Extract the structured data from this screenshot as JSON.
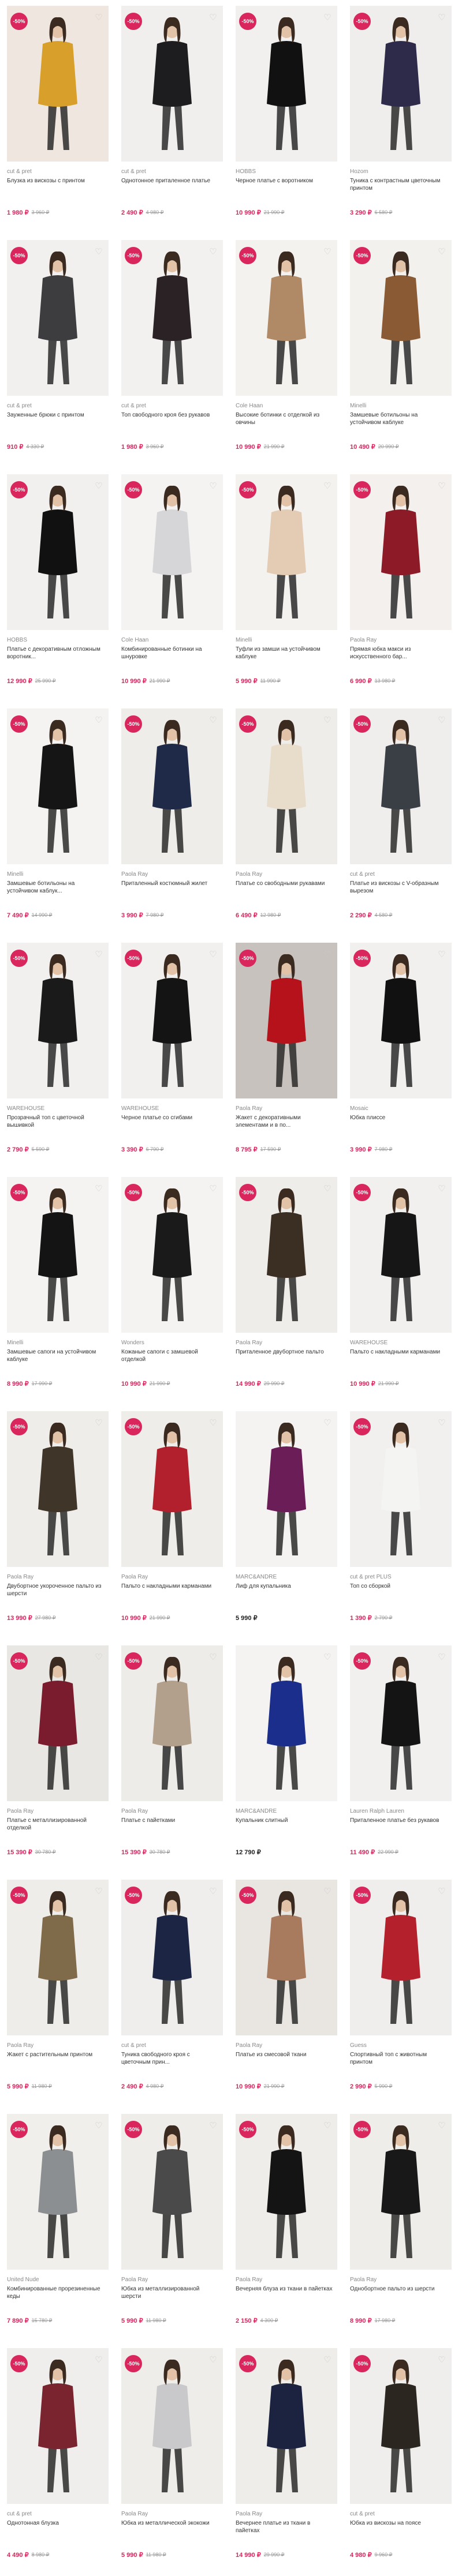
{
  "colors": {
    "accent": "#d9275e",
    "old_price": "#999999",
    "bg_photo": "#f3f1ef"
  },
  "icons": {
    "favorite": "heart-outline-icon"
  },
  "products": [
    {
      "badge": "-50%",
      "brand": "cut & pret",
      "title": "Блузка из вискозы с принтом",
      "price": "1 980 ₽",
      "old_price": "3 960 ₽",
      "bg": "#efe7df",
      "c": "#d8a02b"
    },
    {
      "badge": "-50%",
      "brand": "cut & pret",
      "title": "Однотонное приталенное платье",
      "price": "2 490 ₽",
      "old_price": "4 980 ₽",
      "bg": "#f0efed",
      "c": "#1d1d1f"
    },
    {
      "badge": "-50%",
      "brand": "HOBBS",
      "title": "Черное платье с воротником",
      "price": "10 990 ₽",
      "old_price": "21 990 ₽",
      "bg": "#f1f0ef",
      "c": "#111"
    },
    {
      "badge": "-50%",
      "brand": "Hozom",
      "title": "Туника с контрастным цветочным принтом",
      "price": "3 290 ₽",
      "old_price": "6 580 ₽",
      "bg": "#efeeec",
      "c": "#2e2b4a"
    },
    {
      "badge": "-50%",
      "brand": "cut & pret",
      "title": "Зауженные брюки с принтом",
      "price": "910 ₽",
      "old_price": "4 330 ₽",
      "bg": "#f1f0ee",
      "c": "#3d3d40"
    },
    {
      "badge": "-50%",
      "brand": "cut & pret",
      "title": "Топ свободного кроя без рукавов",
      "price": "1 980 ₽",
      "old_price": "3 960 ₽",
      "bg": "#f2f1ef",
      "c": "#2b2226"
    },
    {
      "badge": "-50%",
      "brand": "Cole Haan",
      "title": "Высокие ботинки с отделкой из овчины",
      "price": "10 990 ₽",
      "old_price": "21 990 ₽",
      "bg": "#f4f2ef",
      "c": "#b08a66"
    },
    {
      "badge": "-50%",
      "brand": "Minelli",
      "title": "Замшевые ботильоны на устойчивом каблуке",
      "price": "10 490 ₽",
      "old_price": "20 990 ₽",
      "bg": "#f3f1ee",
      "c": "#8a5a34"
    },
    {
      "badge": "-50%",
      "brand": "HOBBS",
      "title": "Платье с декоративным отложным воротник...",
      "price": "12 990 ₽",
      "old_price": "25 990 ₽",
      "bg": "#f1f0ef",
      "c": "#111"
    },
    {
      "badge": "-50%",
      "brand": "Cole Haan",
      "title": "Комбинированные ботинки на шнуровке",
      "price": "10 990 ₽",
      "old_price": "21 990 ₽",
      "bg": "#f4f3f2",
      "c": "#d6d6d8"
    },
    {
      "badge": "-50%",
      "brand": "Minelli",
      "title": "Туфли из замши на устойчивом каблуке",
      "price": "5 990 ₽",
      "old_price": "11 990 ₽",
      "bg": "#f4f2ef",
      "c": "#e3cbb4"
    },
    {
      "badge": "-50%",
      "brand": "Paola Ray",
      "title": "Прямая юбка макси из искусственного бар...",
      "price": "6 990 ₽",
      "old_price": "13 980 ₽",
      "bg": "#f3f0ee",
      "c": "#8d1a27"
    },
    {
      "badge": "-50%",
      "brand": "Minelli",
      "title": "Замшевые ботильоны на устойчивом каблук...",
      "price": "7 490 ₽",
      "old_price": "14 990 ₽",
      "bg": "#f4f3f2",
      "c": "#151515"
    },
    {
      "badge": "-50%",
      "brand": "Paola Ray",
      "title": "Приталенный костюмный жилет",
      "price": "3 990 ₽",
      "old_price": "7 980 ₽",
      "bg": "#eeede9",
      "c": "#1f2a49"
    },
    {
      "badge": "-50%",
      "brand": "Paola Ray",
      "title": "Платье со свободными рукавами",
      "price": "6 490 ₽",
      "old_price": "12 980 ₽",
      "bg": "#efede9",
      "c": "#e8dccb"
    },
    {
      "badge": "-50%",
      "brand": "cut & pret",
      "title": "Платье из вискозы с V-образным вырезом",
      "price": "2 290 ₽",
      "old_price": "4 580 ₽",
      "bg": "#efeeec",
      "c": "#3a3f45"
    },
    {
      "badge": "-50%",
      "brand": "WAREHOUSE",
      "title": "Прозрачный топ с цветочной вышивкой",
      "price": "2 790 ₽",
      "old_price": "5 590 ₽",
      "bg": "#f1f0ee",
      "c": "#1a1a1a"
    },
    {
      "badge": "-50%",
      "brand": "WAREHOUSE",
      "title": "Черное платье со сгибами",
      "price": "3 390 ₽",
      "old_price": "6 790 ₽",
      "bg": "#f1f0ee",
      "c": "#141414"
    },
    {
      "badge": "-50%",
      "brand": "Paola Ray",
      "title": "Жакет с декоративными элементами и в по...",
      "price": "8 795 ₽",
      "old_price": "17 590 ₽",
      "bg": "#c7c2bd",
      "c": "#b5121b"
    },
    {
      "badge": "-50%",
      "brand": "Mosaic",
      "title": "Юбка плиссе",
      "price": "3 990 ₽",
      "old_price": "7 980 ₽",
      "bg": "#f1f0ee",
      "c": "#111"
    },
    {
      "badge": "-50%",
      "brand": "Minelli",
      "title": "Замшевые сапоги на устойчивом каблуке",
      "price": "8 990 ₽",
      "old_price": "17 990 ₽",
      "bg": "#f4f3f2",
      "c": "#141414"
    },
    {
      "badge": "-50%",
      "brand": "Wonders",
      "title": "Кожаные сапоги с замшевой отделкой",
      "price": "10 990 ₽",
      "old_price": "21 990 ₽",
      "bg": "#f4f3f2",
      "c": "#1a1a1a"
    },
    {
      "badge": "-50%",
      "brand": "Paola Ray",
      "title": "Приталенное двубортное пальто",
      "price": "14 990 ₽",
      "old_price": "29 990 ₽",
      "bg": "#efede9",
      "c": "#3b2f24"
    },
    {
      "badge": "-50%",
      "brand": "WAREHOUSE",
      "title": "Пальто с накладными карманами",
      "price": "10 990 ₽",
      "old_price": "21 990 ₽",
      "bg": "#f1f0ee",
      "c": "#161616"
    },
    {
      "badge": "-50%",
      "brand": "Paola Ray",
      "title": "Двубортное укороченное пальто из шерсти",
      "price": "13 990 ₽",
      "old_price": "27 980 ₽",
      "bg": "#efede9",
      "c": "#3f3528"
    },
    {
      "badge": "-50%",
      "brand": "Paola Ray",
      "title": "Пальто с накладными карманами",
      "price": "10 990 ₽",
      "old_price": "21 990 ₽",
      "bg": "#efede9",
      "c": "#b21f2d"
    },
    {
      "badge": "",
      "brand": "MARC&ANDRE",
      "title": "Лиф для купальника",
      "price": "5 990 ₽",
      "old_price": "",
      "bg": "#f4f3f2",
      "c": "#6b1d57"
    },
    {
      "badge": "-50%",
      "brand": "cut & pret PLUS",
      "title": "Топ со сборкой",
      "price": "1 390 ₽",
      "old_price": "2 790 ₽",
      "bg": "#f1f0ee",
      "c": "#f4f4f2"
    },
    {
      "badge": "-50%",
      "brand": "Paola Ray",
      "title": "Платье с металлизированной отделкой",
      "price": "15 390 ₽",
      "old_price": "30 780 ₽",
      "bg": "#e9e7e3",
      "c": "#7a1c2e"
    },
    {
      "badge": "-50%",
      "brand": "Paola Ray",
      "title": "Платье с пайетками",
      "price": "15 390 ₽",
      "old_price": "30 780 ₽",
      "bg": "#eeece8",
      "c": "#b3a08c"
    },
    {
      "badge": "",
      "brand": "MARC&ANDRE",
      "title": "Купальник слитный",
      "price": "12 790 ₽",
      "old_price": "",
      "bg": "#f4f3f2",
      "c": "#1b2e8c"
    },
    {
      "badge": "-50%",
      "brand": "Lauren Ralph Lauren",
      "title": "Приталенное платье без рукавов",
      "price": "11 490 ₽",
      "old_price": "22 990 ₽",
      "bg": "#f1f0ee",
      "c": "#141414"
    },
    {
      "badge": "-50%",
      "brand": "Paola Ray",
      "title": "Жакет с растительным принтом",
      "price": "5 990 ₽",
      "old_price": "11 980 ₽",
      "bg": "#efede9",
      "c": "#7f6a4a"
    },
    {
      "badge": "-50%",
      "brand": "cut & pret",
      "title": "Туника свободного кроя с цветочным прин...",
      "price": "2 490 ₽",
      "old_price": "4 980 ₽",
      "bg": "#efeeec",
      "c": "#1c2544"
    },
    {
      "badge": "-50%",
      "brand": "Paola Ray",
      "title": "Платье из смесовой ткани",
      "price": "10 990 ₽",
      "old_price": "21 990 ₽",
      "bg": "#e9e6e2",
      "c": "#a87a5e"
    },
    {
      "badge": "-50%",
      "brand": "Guess",
      "title": "Спортивный топ с животным принтом",
      "price": "2 990 ₽",
      "old_price": "5 990 ₽",
      "bg": "#efeeec",
      "c": "#b4202c"
    },
    {
      "badge": "-50%",
      "brand": "United Nude",
      "title": "Комбинированные прорезиненные кеды",
      "price": "7 890 ₽",
      "old_price": "15 780 ₽",
      "bg": "#f1efec",
      "c": "#8c8f92"
    },
    {
      "badge": "-50%",
      "brand": "Paola Ray",
      "title": "Юбка из металлизированной шерсти",
      "price": "5 990 ₽",
      "old_price": "11 980 ₽",
      "bg": "#efede9",
      "c": "#4a4a4a"
    },
    {
      "badge": "-50%",
      "brand": "Paola Ray",
      "title": "Вечерняя блуза из ткани в пайетках",
      "price": "2 150 ₽",
      "old_price": "4 300 ₽",
      "bg": "#efede9",
      "c": "#141414"
    },
    {
      "badge": "-50%",
      "brand": "Paola Ray",
      "title": "Однобортное пальто из шерсти",
      "price": "8 990 ₽",
      "old_price": "17 980 ₽",
      "bg": "#efede9",
      "c": "#181818"
    },
    {
      "badge": "-50%",
      "brand": "cut & pret",
      "title": "Однотонная блузка",
      "price": "4 490 ₽",
      "old_price": "8 980 ₽",
      "bg": "#efeeec",
      "c": "#7a2430"
    },
    {
      "badge": "-50%",
      "brand": "Paola Ray",
      "title": "Юбка из металлической экокожи",
      "price": "5 990 ₽",
      "old_price": "11 980 ₽",
      "bg": "#efede9",
      "c": "#c9c9cb"
    },
    {
      "badge": "-50%",
      "brand": "Paola Ray",
      "title": "Вечернее платье из ткани в пайетках",
      "price": "14 990 ₽",
      "old_price": "29 990 ₽",
      "bg": "#efede9",
      "c": "#1c2340"
    },
    {
      "badge": "-50%",
      "brand": "cut & pret",
      "title": "Юбка из вискозы на поясе",
      "price": "4 980 ₽",
      "old_price": "9 960 ₽",
      "bg": "#efeeec",
      "c": "#2c2620"
    }
  ]
}
